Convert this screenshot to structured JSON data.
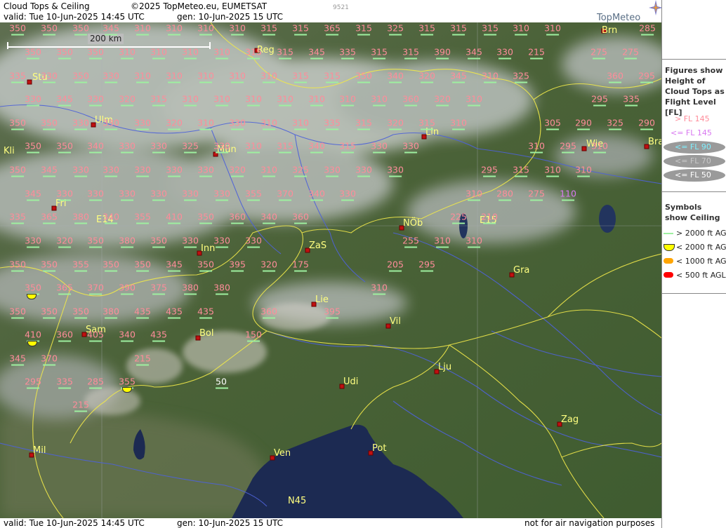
{
  "header": {
    "title": "Cloud Tops & Ceiling",
    "copyright": "©2025 TopMeteo.eu, EUMETSAT",
    "code": "9521",
    "valid": "valid:  Tue  10-Jun-2025  14:45 UTC",
    "gen": "gen: 10-Jun-2025 15 UTC",
    "brand": "TopMeteo"
  },
  "footer": {
    "valid": "valid:  Tue  10-Jun-2025  14:45 UTC",
    "gen": "gen: 10-Jun-2025 15 UTC",
    "disclaimer": "not for air navigation purposes"
  },
  "scale": {
    "label": "200 km"
  },
  "legend": {
    "tops_title": "Figures show Height of Cloud Tops as Flight Level  [FL]",
    "tops": [
      {
        "label": "> FL 145",
        "color": "#ff8c9a"
      },
      {
        "label": "<= FL 145",
        "color": "#d878f0"
      },
      {
        "label": "<= FL 90",
        "color": "#7ff0ff"
      },
      {
        "label": "<= FL 70",
        "color": "#c8c8c8"
      },
      {
        "label": "<= FL 50",
        "color": "#ffffff"
      }
    ],
    "ceiling_title": "Symbols show Ceiling",
    "ceiling": [
      {
        "label": "> 2000 ft AGL",
        "color": "#9ef0a0",
        "symbol": "line"
      },
      {
        "label": "< 2000 ft AGL",
        "color": "#ffff00",
        "symbol": "half-circle"
      },
      {
        "label": "< 1000 ft AGL",
        "color": "#ffa500",
        "symbol": "bar"
      },
      {
        "label": "< 500 ft AGL",
        "color": "#ff0000",
        "symbol": "bar"
      }
    ]
  },
  "cities": [
    {
      "name": "Brn"
    },
    {
      "name": "Reg"
    },
    {
      "name": "Stu"
    },
    {
      "name": "Ulm"
    },
    {
      "name": "Lin"
    },
    {
      "name": "Wie"
    },
    {
      "name": "Bra"
    },
    {
      "name": "Kli"
    },
    {
      "name": "Mün"
    },
    {
      "name": "Fri"
    },
    {
      "name": "E14"
    },
    {
      "name": "NÖb"
    },
    {
      "name": "E15"
    },
    {
      "name": "ZaS"
    },
    {
      "name": "Inn"
    },
    {
      "name": "Gra"
    },
    {
      "name": "Lie"
    },
    {
      "name": "Vil"
    },
    {
      "name": "Sam"
    },
    {
      "name": "Bol"
    },
    {
      "name": "Lju"
    },
    {
      "name": "Udi"
    },
    {
      "name": "Zag"
    },
    {
      "name": "Mil"
    },
    {
      "name": "Ven"
    },
    {
      "name": "Pot"
    },
    {
      "name": "N45"
    }
  ],
  "cloud_tops": [
    {
      "v": "350",
      "c": "#ff8c9a"
    },
    {
      "v": "350",
      "c": "#ff8c9a"
    },
    {
      "v": "350",
      "c": "#ff8c9a"
    },
    {
      "v": "345",
      "c": "#ff8c9a"
    },
    {
      "v": "310",
      "c": "#ff8c9a"
    },
    {
      "v": "310",
      "c": "#ff8c9a"
    },
    {
      "v": "310",
      "c": "#ff8c9a"
    },
    {
      "v": "310",
      "c": "#ff8c9a"
    },
    {
      "v": "315",
      "c": "#ff8c9a"
    },
    {
      "v": "315",
      "c": "#ff8c9a"
    },
    {
      "v": "365",
      "c": "#ff8c9a"
    },
    {
      "v": "315",
      "c": "#ff8c9a"
    },
    {
      "v": "325",
      "c": "#ff8c9a"
    },
    {
      "v": "315",
      "c": "#ff8c9a"
    },
    {
      "v": "315",
      "c": "#ff8c9a"
    },
    {
      "v": "315",
      "c": "#ff8c9a"
    },
    {
      "v": "310",
      "c": "#ff8c9a"
    },
    {
      "v": "310",
      "c": "#ff8c9a"
    },
    {
      "v": "285",
      "c": "#ff8c9a"
    },
    {
      "v": "350",
      "c": "#ff8c9a"
    },
    {
      "v": "350",
      "c": "#ff8c9a"
    },
    {
      "v": "350",
      "c": "#ff8c9a"
    },
    {
      "v": "310",
      "c": "#ff8c9a"
    },
    {
      "v": "310",
      "c": "#ff8c9a"
    },
    {
      "v": "310",
      "c": "#ff8c9a"
    },
    {
      "v": "310",
      "c": "#ff8c9a"
    },
    {
      "v": "315",
      "c": "#ff8c9a"
    },
    {
      "v": "315",
      "c": "#ff8c9a"
    },
    {
      "v": "345",
      "c": "#ff8c9a"
    },
    {
      "v": "335",
      "c": "#ff8c9a"
    },
    {
      "v": "315",
      "c": "#ff8c9a"
    },
    {
      "v": "315",
      "c": "#ff8c9a"
    },
    {
      "v": "390",
      "c": "#ff8c9a"
    },
    {
      "v": "345",
      "c": "#ff8c9a"
    },
    {
      "v": "330",
      "c": "#ff8c9a"
    },
    {
      "v": "215",
      "c": "#ff8c9a"
    },
    {
      "v": "275",
      "c": "#ff8c9a"
    },
    {
      "v": "275",
      "c": "#ff8c9a"
    },
    {
      "v": "335",
      "c": "#ff8c9a"
    },
    {
      "v": "330",
      "c": "#ff8c9a"
    },
    {
      "v": "350",
      "c": "#ff8c9a"
    },
    {
      "v": "330",
      "c": "#ff8c9a"
    },
    {
      "v": "310",
      "c": "#ff8c9a"
    },
    {
      "v": "310",
      "c": "#ff8c9a"
    },
    {
      "v": "310",
      "c": "#ff8c9a"
    },
    {
      "v": "310",
      "c": "#ff8c9a"
    },
    {
      "v": "310",
      "c": "#ff8c9a"
    },
    {
      "v": "315",
      "c": "#ff8c9a"
    },
    {
      "v": "315",
      "c": "#ff8c9a"
    },
    {
      "v": "350",
      "c": "#ff8c9a"
    },
    {
      "v": "340",
      "c": "#ff8c9a"
    },
    {
      "v": "320",
      "c": "#ff8c9a"
    },
    {
      "v": "345",
      "c": "#ff8c9a"
    },
    {
      "v": "310",
      "c": "#ff8c9a"
    },
    {
      "v": "325",
      "c": "#ff8c9a"
    },
    {
      "v": "360",
      "c": "#ff8c9a"
    },
    {
      "v": "295",
      "c": "#ff8c9a"
    },
    {
      "v": "330",
      "c": "#ff8c9a"
    },
    {
      "v": "345",
      "c": "#ff8c9a"
    },
    {
      "v": "330",
      "c": "#ff8c9a"
    },
    {
      "v": "320",
      "c": "#ff8c9a"
    },
    {
      "v": "315",
      "c": "#ff8c9a"
    },
    {
      "v": "310",
      "c": "#ff8c9a"
    },
    {
      "v": "310",
      "c": "#ff8c9a"
    },
    {
      "v": "310",
      "c": "#ff8c9a"
    },
    {
      "v": "310",
      "c": "#ff8c9a"
    },
    {
      "v": "310",
      "c": "#ff8c9a"
    },
    {
      "v": "310",
      "c": "#ff8c9a"
    },
    {
      "v": "310",
      "c": "#ff8c9a"
    },
    {
      "v": "360",
      "c": "#ff8c9a"
    },
    {
      "v": "320",
      "c": "#ff8c9a"
    },
    {
      "v": "310",
      "c": "#ff8c9a"
    },
    {
      "v": "295",
      "c": "#ff8c9a"
    },
    {
      "v": "335",
      "c": "#ff8c9a"
    },
    {
      "v": "310",
      "c": "#ff8c9a"
    },
    {
      "v": "350",
      "c": "#ff8c9a"
    },
    {
      "v": "350",
      "c": "#ff8c9a"
    },
    {
      "v": "330",
      "c": "#ff8c9a"
    },
    {
      "v": "330",
      "c": "#ff8c9a"
    },
    {
      "v": "330",
      "c": "#ff8c9a"
    },
    {
      "v": "320",
      "c": "#ff8c9a"
    },
    {
      "v": "310",
      "c": "#ff8c9a"
    },
    {
      "v": "330",
      "c": "#ff8c9a"
    },
    {
      "v": "310",
      "c": "#ff8c9a"
    },
    {
      "v": "310",
      "c": "#ff8c9a"
    },
    {
      "v": "335",
      "c": "#ff8c9a"
    },
    {
      "v": "315",
      "c": "#ff8c9a"
    },
    {
      "v": "320",
      "c": "#ff8c9a"
    },
    {
      "v": "315",
      "c": "#ff8c9a"
    },
    {
      "v": "310",
      "c": "#ff8c9a"
    },
    {
      "v": "305",
      "c": "#ff8c9a"
    },
    {
      "v": "290",
      "c": "#ff8c9a"
    },
    {
      "v": "325",
      "c": "#ff8c9a"
    },
    {
      "v": "290",
      "c": "#ff8c9a"
    },
    {
      "v": "350",
      "c": "#ff8c9a"
    },
    {
      "v": "350",
      "c": "#ff8c9a"
    },
    {
      "v": "340",
      "c": "#ff8c9a"
    },
    {
      "v": "330",
      "c": "#ff8c9a"
    },
    {
      "v": "330",
      "c": "#ff8c9a"
    },
    {
      "v": "325",
      "c": "#ff8c9a"
    },
    {
      "v": "330",
      "c": "#ff8c9a"
    },
    {
      "v": "310",
      "c": "#ff8c9a"
    },
    {
      "v": "315",
      "c": "#ff8c9a"
    },
    {
      "v": "340",
      "c": "#ff8c9a"
    },
    {
      "v": "315",
      "c": "#ff8c9a"
    },
    {
      "v": "330",
      "c": "#ff8c9a"
    },
    {
      "v": "330",
      "c": "#ff8c9a"
    },
    {
      "v": "310",
      "c": "#ff8c9a"
    },
    {
      "v": "295",
      "c": "#ff8c9a"
    },
    {
      "v": "310",
      "c": "#ff8c9a"
    },
    {
      "v": "350",
      "c": "#ff8c9a"
    },
    {
      "v": "345",
      "c": "#ff8c9a"
    },
    {
      "v": "330",
      "c": "#ff8c9a"
    },
    {
      "v": "330",
      "c": "#ff8c9a"
    },
    {
      "v": "330",
      "c": "#ff8c9a"
    },
    {
      "v": "330",
      "c": "#ff8c9a"
    },
    {
      "v": "330",
      "c": "#ff8c9a"
    },
    {
      "v": "320",
      "c": "#ff8c9a"
    },
    {
      "v": "310",
      "c": "#ff8c9a"
    },
    {
      "v": "325",
      "c": "#ff8c9a"
    },
    {
      "v": "330",
      "c": "#ff8c9a"
    },
    {
      "v": "330",
      "c": "#ff8c9a"
    },
    {
      "v": "330",
      "c": "#ff8c9a"
    },
    {
      "v": "295",
      "c": "#ff8c9a"
    },
    {
      "v": "315",
      "c": "#ff8c9a"
    },
    {
      "v": "310",
      "c": "#ff8c9a"
    },
    {
      "v": "310",
      "c": "#ff8c9a"
    },
    {
      "v": "345",
      "c": "#ff8c9a"
    },
    {
      "v": "330",
      "c": "#ff8c9a"
    },
    {
      "v": "330",
      "c": "#ff8c9a"
    },
    {
      "v": "330",
      "c": "#ff8c9a"
    },
    {
      "v": "330",
      "c": "#ff8c9a"
    },
    {
      "v": "330",
      "c": "#ff8c9a"
    },
    {
      "v": "330",
      "c": "#ff8c9a"
    },
    {
      "v": "355",
      "c": "#ff8c9a"
    },
    {
      "v": "370",
      "c": "#ff8c9a"
    },
    {
      "v": "340",
      "c": "#ff8c9a"
    },
    {
      "v": "330",
      "c": "#ff8c9a"
    },
    {
      "v": "310",
      "c": "#ff8c9a"
    },
    {
      "v": "280",
      "c": "#ff8c9a"
    },
    {
      "v": "275",
      "c": "#ff8c9a"
    },
    {
      "v": "110",
      "c": "#d878f0"
    },
    {
      "v": "335",
      "c": "#ff8c9a"
    },
    {
      "v": "365",
      "c": "#ff8c9a"
    },
    {
      "v": "380",
      "c": "#ff8c9a"
    },
    {
      "v": "340",
      "c": "#ff8c9a"
    },
    {
      "v": "355",
      "c": "#ff8c9a"
    },
    {
      "v": "410",
      "c": "#ff8c9a"
    },
    {
      "v": "350",
      "c": "#ff8c9a"
    },
    {
      "v": "360",
      "c": "#ff8c9a"
    },
    {
      "v": "340",
      "c": "#ff8c9a"
    },
    {
      "v": "360",
      "c": "#ff8c9a"
    },
    {
      "v": "225",
      "c": "#ff8c9a"
    },
    {
      "v": "210",
      "c": "#ff8c9a"
    },
    {
      "v": "330",
      "c": "#ff8c9a"
    },
    {
      "v": "320",
      "c": "#ff8c9a"
    },
    {
      "v": "350",
      "c": "#ff8c9a"
    },
    {
      "v": "380",
      "c": "#ff8c9a"
    },
    {
      "v": "350",
      "c": "#ff8c9a"
    },
    {
      "v": "330",
      "c": "#ff8c9a"
    },
    {
      "v": "330",
      "c": "#ff8c9a"
    },
    {
      "v": "330",
      "c": "#ff8c9a"
    },
    {
      "v": "255",
      "c": "#ff8c9a"
    },
    {
      "v": "310",
      "c": "#ff8c9a"
    },
    {
      "v": "310",
      "c": "#ff8c9a"
    },
    {
      "v": "350",
      "c": "#ff8c9a"
    },
    {
      "v": "350",
      "c": "#ff8c9a"
    },
    {
      "v": "355",
      "c": "#ff8c9a"
    },
    {
      "v": "350",
      "c": "#ff8c9a"
    },
    {
      "v": "350",
      "c": "#ff8c9a"
    },
    {
      "v": "345",
      "c": "#ff8c9a"
    },
    {
      "v": "350",
      "c": "#ff8c9a"
    },
    {
      "v": "395",
      "c": "#ff8c9a"
    },
    {
      "v": "320",
      "c": "#ff8c9a"
    },
    {
      "v": "175",
      "c": "#ff8c9a"
    },
    {
      "v": "205",
      "c": "#ff8c9a"
    },
    {
      "v": "295",
      "c": "#ff8c9a"
    },
    {
      "v": "350",
      "c": "#ff8c9a"
    },
    {
      "v": "365",
      "c": "#ff8c9a"
    },
    {
      "v": "370",
      "c": "#ff8c9a"
    },
    {
      "v": "390",
      "c": "#ff8c9a"
    },
    {
      "v": "375",
      "c": "#ff8c9a"
    },
    {
      "v": "380",
      "c": "#ff8c9a"
    },
    {
      "v": "380",
      "c": "#ff8c9a"
    },
    {
      "v": "310",
      "c": "#ff8c9a"
    },
    {
      "v": "350",
      "c": "#ff8c9a"
    },
    {
      "v": "350",
      "c": "#ff8c9a"
    },
    {
      "v": "350",
      "c": "#ff8c9a"
    },
    {
      "v": "380",
      "c": "#ff8c9a"
    },
    {
      "v": "435",
      "c": "#ff8c9a"
    },
    {
      "v": "435",
      "c": "#ff8c9a"
    },
    {
      "v": "435",
      "c": "#ff8c9a"
    },
    {
      "v": "360",
      "c": "#ff8c9a"
    },
    {
      "v": "395",
      "c": "#ff8c9a"
    },
    {
      "v": "410",
      "c": "#ff8c9a"
    },
    {
      "v": "360",
      "c": "#ff8c9a"
    },
    {
      "v": "405",
      "c": "#ff8c9a"
    },
    {
      "v": "340",
      "c": "#ff8c9a"
    },
    {
      "v": "435",
      "c": "#ff8c9a"
    },
    {
      "v": "150",
      "c": "#ff8c9a"
    },
    {
      "v": "345",
      "c": "#ff8c9a"
    },
    {
      "v": "370",
      "c": "#ff8c9a"
    },
    {
      "v": "215",
      "c": "#ff8c9a"
    },
    {
      "v": "295",
      "c": "#ff8c9a"
    },
    {
      "v": "335",
      "c": "#ff8c9a"
    },
    {
      "v": "285",
      "c": "#ff8c9a"
    },
    {
      "v": "355",
      "c": "#ff8c9a"
    },
    {
      "v": "50",
      "c": "#ffffff"
    },
    {
      "v": "215",
      "c": "#ff8c9a"
    }
  ],
  "ceiling_marks": [
    {
      "type": "half-circle",
      "color": "#ffff00"
    },
    {
      "type": "half-circle",
      "color": "#ffff00"
    },
    {
      "type": "half-circle",
      "color": "#ffff00"
    }
  ]
}
